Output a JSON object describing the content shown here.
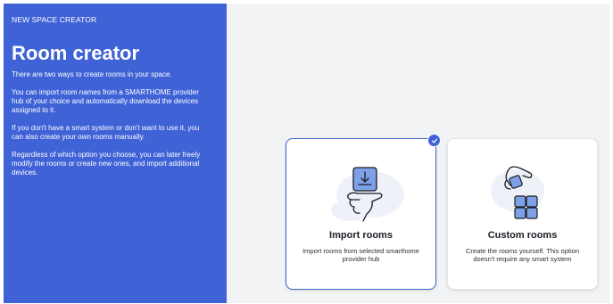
{
  "sidebar": {
    "overline": "NEW SPACE CREATOR",
    "title": "Room creator",
    "paragraphs": [
      "There are two ways to create rooms in your space.",
      "You can import room names from a SMARTHOME provider hub of your choice and automatically download the devices assigned to it.",
      "If you don't have a smart system or don't want to use it, you can also create your own rooms manually.",
      "Regardless of which option you choose, you can later freely modify the rooms or create new ones, and import additional devices."
    ]
  },
  "options": {
    "import": {
      "label": "Import rooms",
      "description": "Import rooms from selected smarthome provider hub",
      "icon": "hand-download-icon",
      "selected": true
    },
    "custom": {
      "label": "Custom rooms",
      "description": "Create the rooms yourself. This option doesn't require any smart system",
      "icon": "hand-blocks-icon",
      "selected": false
    }
  },
  "colors": {
    "accent": "#3f62d6",
    "background": "#f2f3f5"
  }
}
